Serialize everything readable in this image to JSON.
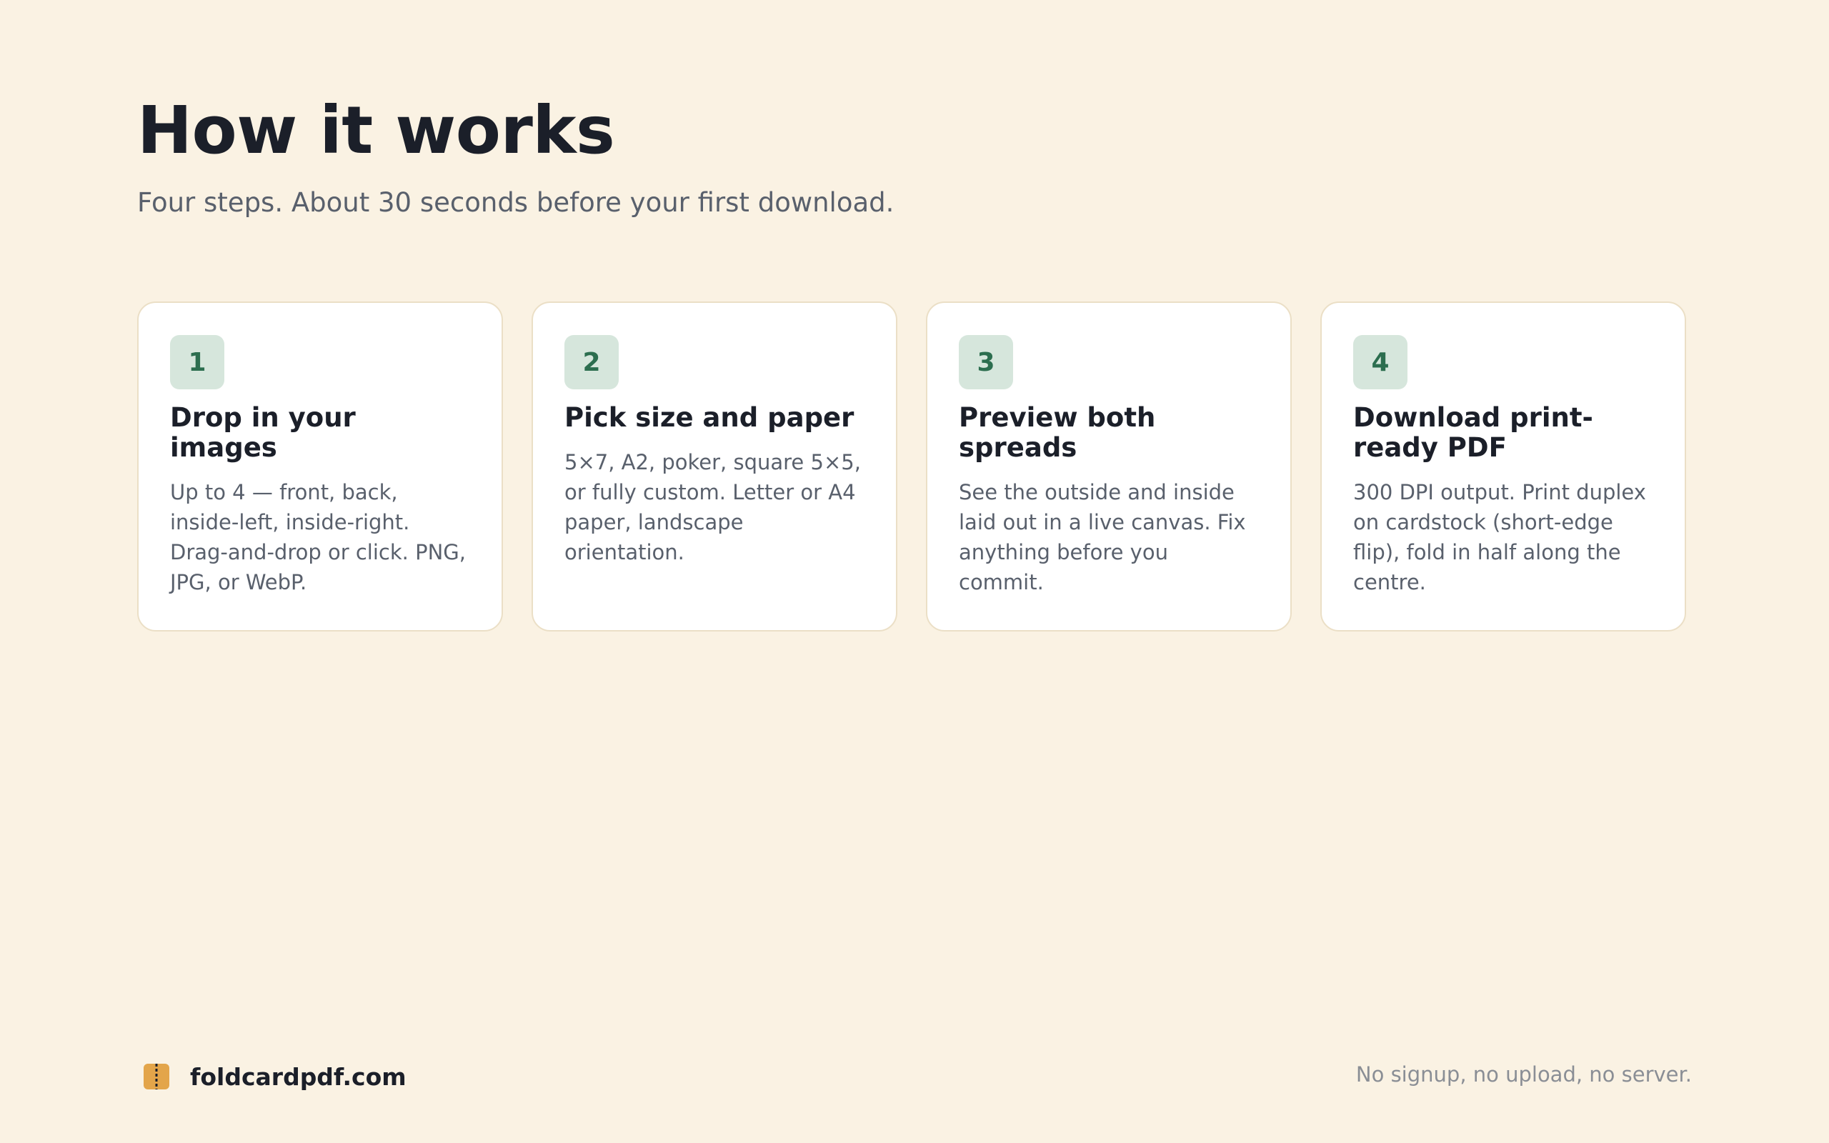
{
  "header": {
    "title": "How it works",
    "subtitle": "Four steps. About 30 seconds before your first download."
  },
  "steps": [
    {
      "number": "1",
      "title": "Drop in your images",
      "description": "Up to 4 — front, back, inside-left, inside-right. Drag-and-drop or click. PNG, JPG, or WebP."
    },
    {
      "number": "2",
      "title": "Pick size and paper",
      "description": "5×7, A2, poker, square 5×5, or fully custom. Letter or A4 paper, landscape orientation."
    },
    {
      "number": "3",
      "title": "Preview both spreads",
      "description": "See the outside and inside laid out in a live canvas. Fix anything before you commit."
    },
    {
      "number": "4",
      "title": "Download print-ready PDF",
      "description": "300 DPI output. Print duplex on cardstock (short-edge flip), fold in half along the centre."
    }
  ],
  "footer": {
    "brand_icon": "folded-card-icon",
    "brand_name": "foldcardpdf.com",
    "note": "No signup, no upload, no server."
  },
  "colors": {
    "background": "#faf2e3",
    "card": "#ffffff",
    "accent": "#2c6e4f",
    "accent_bg": "#d6e6dc",
    "brand_icon": "#e3a54a"
  }
}
